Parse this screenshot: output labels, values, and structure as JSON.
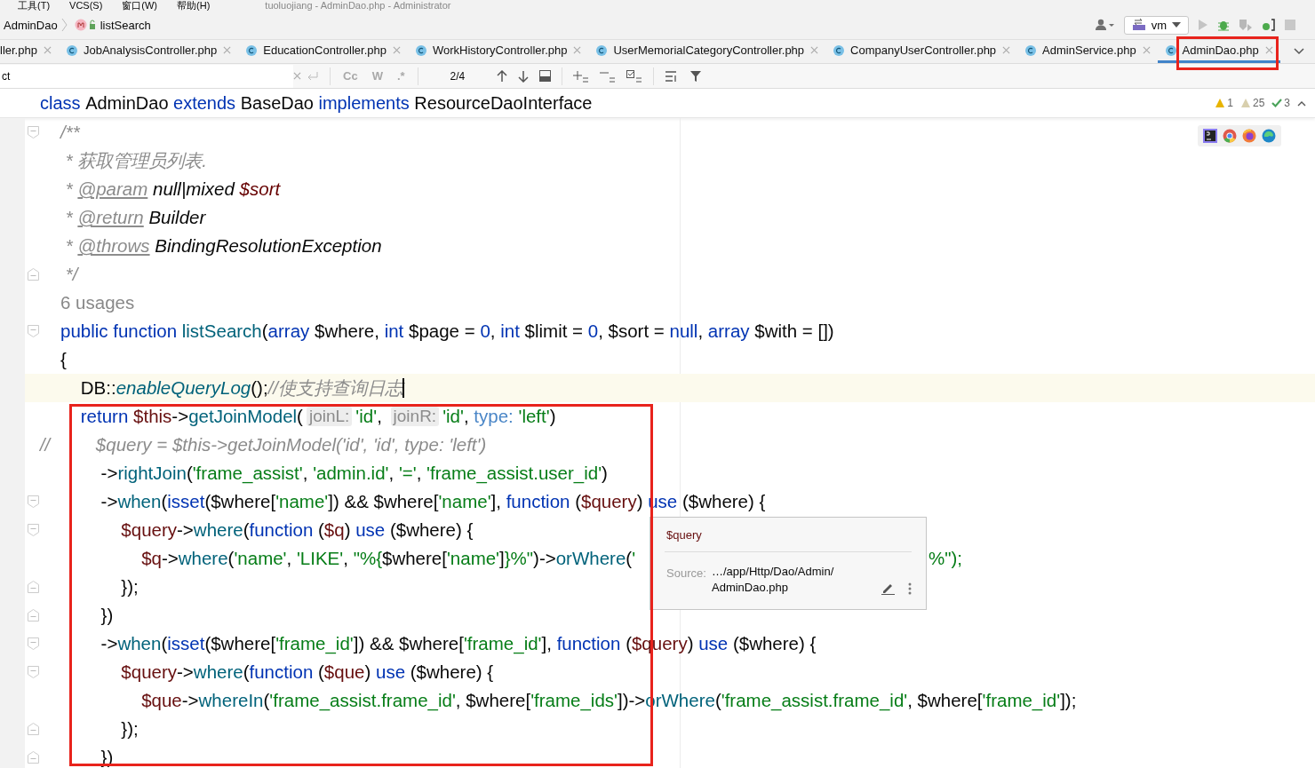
{
  "menu": [
    {
      "label": "工具(T)"
    },
    {
      "label": "VCS(S)"
    },
    {
      "label": "窗口(W)"
    },
    {
      "label": "帮助(H)"
    }
  ],
  "window_title": "tuoluojiang - AdminDao.php - Administrator",
  "breadcrumb": [
    {
      "kind": "class",
      "label": "AdminDao"
    },
    {
      "kind": "method",
      "label": "listSearch"
    }
  ],
  "run_config": {
    "label": "vm"
  },
  "tabs": [
    {
      "label": "ller.php",
      "selected": false,
      "class_icon": false
    },
    {
      "label": "JobAnalysisController.php",
      "selected": false,
      "class_icon": true
    },
    {
      "label": "EducationController.php",
      "selected": false,
      "class_icon": true
    },
    {
      "label": "WorkHistoryController.php",
      "selected": false,
      "class_icon": true
    },
    {
      "label": "UserMemorialCategoryController.php",
      "selected": false,
      "class_icon": true
    },
    {
      "label": "CompanyUserController.php",
      "selected": false,
      "class_icon": true
    },
    {
      "label": "AdminService.php",
      "selected": false,
      "class_icon": true
    },
    {
      "label": "AdminDao.php",
      "selected": true,
      "class_icon": true
    }
  ],
  "find_bar": {
    "value": "ct",
    "options": [
      {
        "label": "Cc",
        "on": false
      },
      {
        "label": "W",
        "on": false
      },
      {
        "label": ".*",
        "on": false
      }
    ],
    "match_count": "2/4"
  },
  "editor": {
    "header": [
      {
        "kind": "kw",
        "text": "class "
      },
      {
        "kind": "plain",
        "text": "AdminDao "
      },
      {
        "kind": "kw",
        "text": "extends "
      },
      {
        "kind": "plain",
        "text": "BaseDao "
      },
      {
        "kind": "kw",
        "text": "implements "
      },
      {
        "kind": "plain",
        "text": "ResourceDaoInterface"
      }
    ],
    "inspections": [
      {
        "kind": "error",
        "count": "1"
      },
      {
        "kind": "warning",
        "count": "25"
      },
      {
        "kind": "typo",
        "count": "3"
      }
    ],
    "lines": [
      {
        "fold_start": true,
        "fold_end": false,
        "tokens": [
          {
            "kind": "doc",
            "text": "/**"
          }
        ]
      },
      {
        "fold_start": false,
        "fold_end": false,
        "tokens": [
          {
            "kind": "doc",
            "text": " * 获取管理员列表."
          }
        ]
      },
      {
        "fold_start": false,
        "fold_end": false,
        "tokens": [
          {
            "kind": "doc",
            "text": " * "
          },
          {
            "kind": "doctag",
            "text": "@param"
          },
          {
            "kind": "doctype",
            "text": " null|mixed "
          },
          {
            "kind": "docvar",
            "text": "$sort"
          }
        ]
      },
      {
        "fold_start": false,
        "fold_end": false,
        "tokens": [
          {
            "kind": "doc",
            "text": " * "
          },
          {
            "kind": "doctag",
            "text": "@return"
          },
          {
            "kind": "doctype",
            "text": " Builder"
          }
        ]
      },
      {
        "fold_start": false,
        "fold_end": false,
        "tokens": [
          {
            "kind": "doc",
            "text": " * "
          },
          {
            "kind": "doctag",
            "text": "@throws"
          },
          {
            "kind": "doctype",
            "text": " BindingResolutionException"
          }
        ]
      },
      {
        "fold_start": false,
        "fold_end": true,
        "tokens": [
          {
            "kind": "doc",
            "text": " */"
          }
        ]
      },
      {
        "fold_start": false,
        "fold_end": false,
        "tokens": [
          {
            "kind": "inlay",
            "text": "6 usages"
          }
        ]
      },
      {
        "fold_start": true,
        "fold_end": false,
        "tokens": [
          {
            "kind": "kw",
            "text": "public function "
          },
          {
            "kind": "fn",
            "text": "listSearch"
          },
          {
            "kind": "plain",
            "text": "("
          },
          {
            "kind": "kw",
            "text": "array "
          },
          {
            "kind": "plain",
            "text": "$where, "
          },
          {
            "kind": "kw",
            "text": "int "
          },
          {
            "kind": "plain",
            "text": "$page = "
          },
          {
            "kind": "kw",
            "text": "0"
          },
          {
            "kind": "plain",
            "text": ", "
          },
          {
            "kind": "kw",
            "text": "int "
          },
          {
            "kind": "plain",
            "text": "$limit = "
          },
          {
            "kind": "kw",
            "text": "0"
          },
          {
            "kind": "plain",
            "text": ", $sort = "
          },
          {
            "kind": "kw",
            "text": "null"
          },
          {
            "kind": "plain",
            "text": ", "
          },
          {
            "kind": "kw",
            "text": "array "
          },
          {
            "kind": "plain",
            "text": "$with = [])"
          }
        ]
      },
      {
        "fold_start": false,
        "fold_end": false,
        "tokens": [
          {
            "kind": "plain",
            "text": "{"
          }
        ]
      },
      {
        "fold_start": false,
        "fold_end": false,
        "current": true,
        "caret": true,
        "tokens": [
          {
            "kind": "plain",
            "text": "    DB"
          },
          {
            "kind": "plain",
            "text": "::"
          },
          {
            "kind": "fni",
            "text": "enableQueryLog"
          },
          {
            "kind": "plain",
            "text": "();"
          },
          {
            "kind": "comment",
            "text": "//使支持查询日志"
          }
        ]
      },
      {
        "fold_start": false,
        "fold_end": false,
        "tokens": [
          {
            "kind": "kw",
            "text": "    return "
          },
          {
            "kind": "var",
            "text": "$this"
          },
          {
            "kind": "plain",
            "text": "->"
          },
          {
            "kind": "fn",
            "text": "getJoinModel"
          },
          {
            "kind": "plain",
            "text": "("
          },
          {
            "kind": "hint",
            "text": "joinL:"
          },
          {
            "kind": "str",
            "text": "'id'"
          },
          {
            "kind": "plain",
            "text": ", "
          },
          {
            "kind": "hint",
            "text": "joinR:"
          },
          {
            "kind": "str",
            "text": "'id'"
          },
          {
            "kind": "plain",
            "text": ", "
          },
          {
            "kind": "named",
            "text": "type: "
          },
          {
            "kind": "str",
            "text": "'left'"
          },
          {
            "kind": "plain",
            "text": ")"
          }
        ]
      },
      {
        "fold_start": false,
        "fold_end": false,
        "gutter": "//",
        "tokens": [
          {
            "kind": "comment",
            "text": "       $query = $this->getJoinModel('id', 'id', type: 'left')"
          }
        ]
      },
      {
        "fold_start": false,
        "fold_end": false,
        "tokens": [
          {
            "kind": "plain",
            "text": "        ->"
          },
          {
            "kind": "fn",
            "text": "rightJoin"
          },
          {
            "kind": "plain",
            "text": "("
          },
          {
            "kind": "str",
            "text": "'frame_assist'"
          },
          {
            "kind": "plain",
            "text": ", "
          },
          {
            "kind": "str",
            "text": "'admin.id'"
          },
          {
            "kind": "plain",
            "text": ", "
          },
          {
            "kind": "str",
            "text": "'='"
          },
          {
            "kind": "plain",
            "text": ", "
          },
          {
            "kind": "str",
            "text": "'frame_assist.user_id'"
          },
          {
            "kind": "plain",
            "text": ")"
          }
        ]
      },
      {
        "fold_start": true,
        "fold_end": false,
        "tokens": [
          {
            "kind": "plain",
            "text": "        ->"
          },
          {
            "kind": "fn",
            "text": "when"
          },
          {
            "kind": "plain",
            "text": "("
          },
          {
            "kind": "kw",
            "text": "isset"
          },
          {
            "kind": "plain",
            "text": "($where["
          },
          {
            "kind": "str",
            "text": "'name'"
          },
          {
            "kind": "plain",
            "text": "]) && $where["
          },
          {
            "kind": "str",
            "text": "'name'"
          },
          {
            "kind": "plain",
            "text": "], "
          },
          {
            "kind": "kw",
            "text": "function "
          },
          {
            "kind": "plain",
            "text": "("
          },
          {
            "kind": "var",
            "text": "$query"
          },
          {
            "kind": "plain",
            "text": ") "
          },
          {
            "kind": "kw",
            "text": "use "
          },
          {
            "kind": "plain",
            "text": "($where) {"
          }
        ]
      },
      {
        "fold_start": true,
        "fold_end": false,
        "tokens": [
          {
            "kind": "var",
            "text": "            $query"
          },
          {
            "kind": "plain",
            "text": "->"
          },
          {
            "kind": "fn",
            "text": "where"
          },
          {
            "kind": "plain",
            "text": "("
          },
          {
            "kind": "kw",
            "text": "function "
          },
          {
            "kind": "plain",
            "text": "("
          },
          {
            "kind": "var",
            "text": "$q"
          },
          {
            "kind": "plain",
            "text": ") "
          },
          {
            "kind": "kw",
            "text": "use "
          },
          {
            "kind": "plain",
            "text": "($where) {"
          }
        ]
      },
      {
        "fold_start": false,
        "fold_end": false,
        "tail": "%\");",
        "tokens": [
          {
            "kind": "var",
            "text": "                $q"
          },
          {
            "kind": "plain",
            "text": "->"
          },
          {
            "kind": "fn",
            "text": "where"
          },
          {
            "kind": "plain",
            "text": "("
          },
          {
            "kind": "str",
            "text": "'name'"
          },
          {
            "kind": "plain",
            "text": ", "
          },
          {
            "kind": "str",
            "text": "'LIKE'"
          },
          {
            "kind": "plain",
            "text": ", "
          },
          {
            "kind": "str",
            "text": "\"%{"
          },
          {
            "kind": "plain",
            "text": "$where["
          },
          {
            "kind": "str",
            "text": "'name'"
          },
          {
            "kind": "plain",
            "text": "]"
          },
          {
            "kind": "str",
            "text": "}%\""
          },
          {
            "kind": "plain",
            "text": ")->"
          },
          {
            "kind": "fn",
            "text": "orWhere"
          },
          {
            "kind": "plain",
            "text": "("
          },
          {
            "kind": "str",
            "text": "'"
          }
        ]
      },
      {
        "fold_start": false,
        "fold_end": true,
        "tokens": [
          {
            "kind": "plain",
            "text": "            });"
          }
        ]
      },
      {
        "fold_start": false,
        "fold_end": true,
        "tokens": [
          {
            "kind": "plain",
            "text": "        })"
          }
        ]
      },
      {
        "fold_start": true,
        "fold_end": false,
        "tokens": [
          {
            "kind": "plain",
            "text": "        ->"
          },
          {
            "kind": "fn",
            "text": "when"
          },
          {
            "kind": "plain",
            "text": "("
          },
          {
            "kind": "kw",
            "text": "isset"
          },
          {
            "kind": "plain",
            "text": "($where["
          },
          {
            "kind": "str",
            "text": "'frame_id'"
          },
          {
            "kind": "plain",
            "text": "]) && $where["
          },
          {
            "kind": "str",
            "text": "'frame_id'"
          },
          {
            "kind": "plain",
            "text": "], "
          },
          {
            "kind": "kw",
            "text": "function "
          },
          {
            "kind": "plain",
            "text": "("
          },
          {
            "kind": "var",
            "text": "$query"
          },
          {
            "kind": "plain",
            "text": ") "
          },
          {
            "kind": "kw",
            "text": "use "
          },
          {
            "kind": "plain",
            "text": "($where) {"
          }
        ]
      },
      {
        "fold_start": true,
        "fold_end": false,
        "tokens": [
          {
            "kind": "var",
            "text": "            $query"
          },
          {
            "kind": "plain",
            "text": "->"
          },
          {
            "kind": "fn",
            "text": "where"
          },
          {
            "kind": "plain",
            "text": "("
          },
          {
            "kind": "kw",
            "text": "function "
          },
          {
            "kind": "plain",
            "text": "("
          },
          {
            "kind": "var",
            "text": "$que"
          },
          {
            "kind": "plain",
            "text": ") "
          },
          {
            "kind": "kw",
            "text": "use "
          },
          {
            "kind": "plain",
            "text": "($where) {"
          }
        ]
      },
      {
        "fold_start": false,
        "fold_end": false,
        "tokens": [
          {
            "kind": "var",
            "text": "                $que"
          },
          {
            "kind": "plain",
            "text": "->"
          },
          {
            "kind": "fn",
            "text": "whereIn"
          },
          {
            "kind": "plain",
            "text": "("
          },
          {
            "kind": "str",
            "text": "'frame_assist.frame_id'"
          },
          {
            "kind": "plain",
            "text": ", $where["
          },
          {
            "kind": "str",
            "text": "'frame_ids'"
          },
          {
            "kind": "plain",
            "text": "])->"
          },
          {
            "kind": "fn",
            "text": "orWhere"
          },
          {
            "kind": "plain",
            "text": "("
          },
          {
            "kind": "str",
            "text": "'frame_assist.frame_id'"
          },
          {
            "kind": "plain",
            "text": ", $where["
          },
          {
            "kind": "str",
            "text": "'frame_id'"
          },
          {
            "kind": "plain",
            "text": "]);"
          }
        ]
      },
      {
        "fold_start": false,
        "fold_end": true,
        "tokens": [
          {
            "kind": "plain",
            "text": "            });"
          }
        ]
      },
      {
        "fold_start": false,
        "fold_end": true,
        "tokens": [
          {
            "kind": "plain",
            "text": "        })"
          }
        ]
      }
    ],
    "tooltip": {
      "title": "$query",
      "source_label": "Source:",
      "path": [
        "…/app/Http/Dao/Admin/",
        "AdminDao.php"
      ]
    }
  }
}
